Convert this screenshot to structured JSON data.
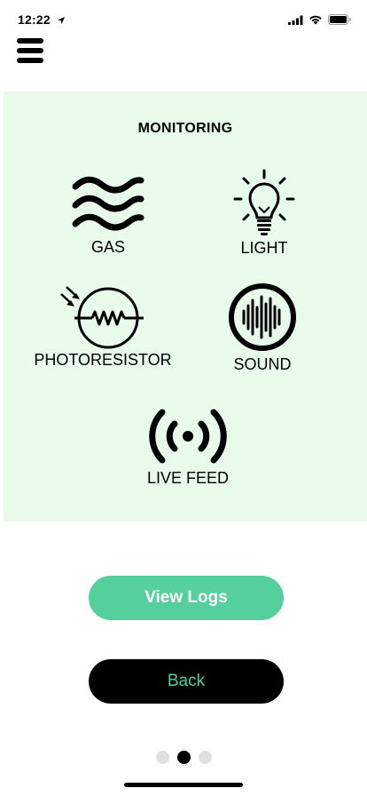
{
  "status_bar": {
    "time": "12:22",
    "icons": [
      "location-arrow-icon",
      "signal-icon",
      "wifi-icon",
      "battery-icon"
    ]
  },
  "menu": {
    "icon": "hamburger-menu-icon"
  },
  "monitoring": {
    "title": "MONITORING",
    "items": [
      {
        "label": "GAS",
        "icon": "gas-waves-icon"
      },
      {
        "label": "LIGHT",
        "icon": "light-bulb-icon"
      },
      {
        "label": "PHOTORESISTOR",
        "icon": "photoresistor-icon"
      },
      {
        "label": "SOUND",
        "icon": "sound-wave-icon"
      },
      {
        "label": "LIVE FEED",
        "icon": "live-feed-icon"
      }
    ],
    "background": "#e8fbeb"
  },
  "buttons": {
    "view_logs": "View Logs",
    "back": "Back"
  },
  "pagination": {
    "count": 3,
    "active_index": 1
  },
  "colors": {
    "accent": "#55cf9b",
    "back_text": "#3dd7a3",
    "dark": "#000000"
  }
}
